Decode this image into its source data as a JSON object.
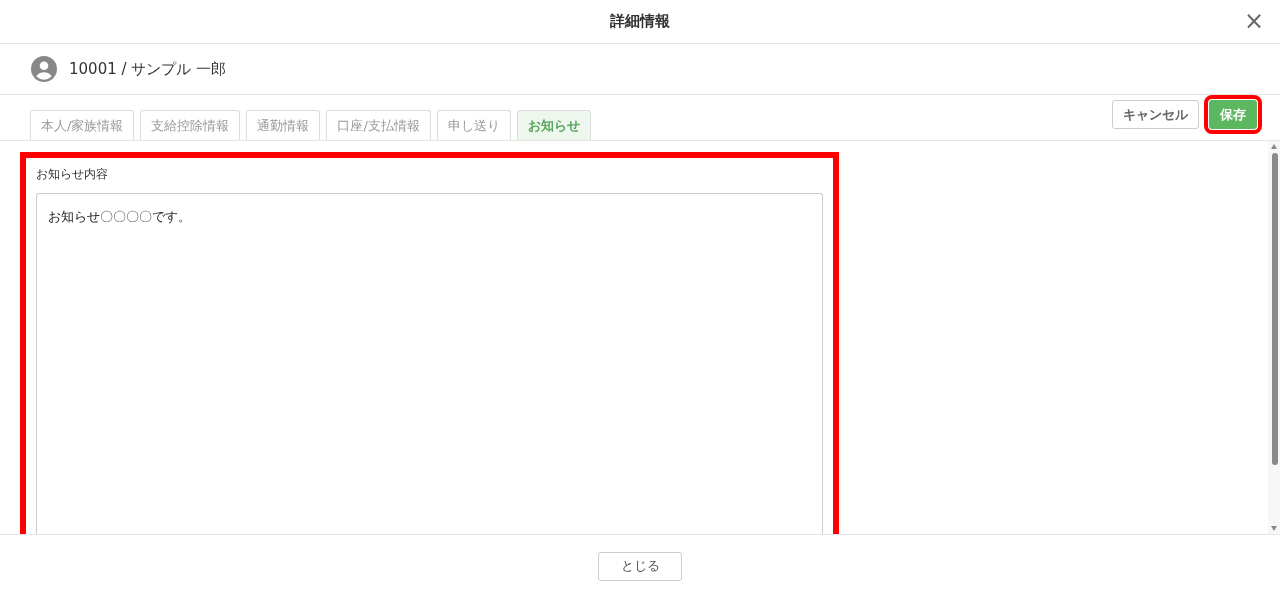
{
  "window": {
    "title": "詳細情報",
    "close": "×"
  },
  "employee": {
    "label": "10001 / サンプル 一郎"
  },
  "tabs": [
    {
      "label": "本人/家族情報",
      "selected": false
    },
    {
      "label": "支給控除情報",
      "selected": false
    },
    {
      "label": "通勤情報",
      "selected": false
    },
    {
      "label": "口座/支払情報",
      "selected": false
    },
    {
      "label": "申し送り",
      "selected": false
    },
    {
      "label": "お知らせ",
      "selected": true
    }
  ],
  "actions": [
    {
      "label": "キャンセル",
      "kind": "secondary",
      "highlighted": false
    },
    {
      "label": "保存",
      "kind": "primary",
      "highlighted": true
    }
  ],
  "notice": {
    "label": "お知らせ内容",
    "value": "お知らせ〇〇〇〇です。",
    "highlighted": true
  },
  "footer": {
    "close_button": "とじる"
  }
}
